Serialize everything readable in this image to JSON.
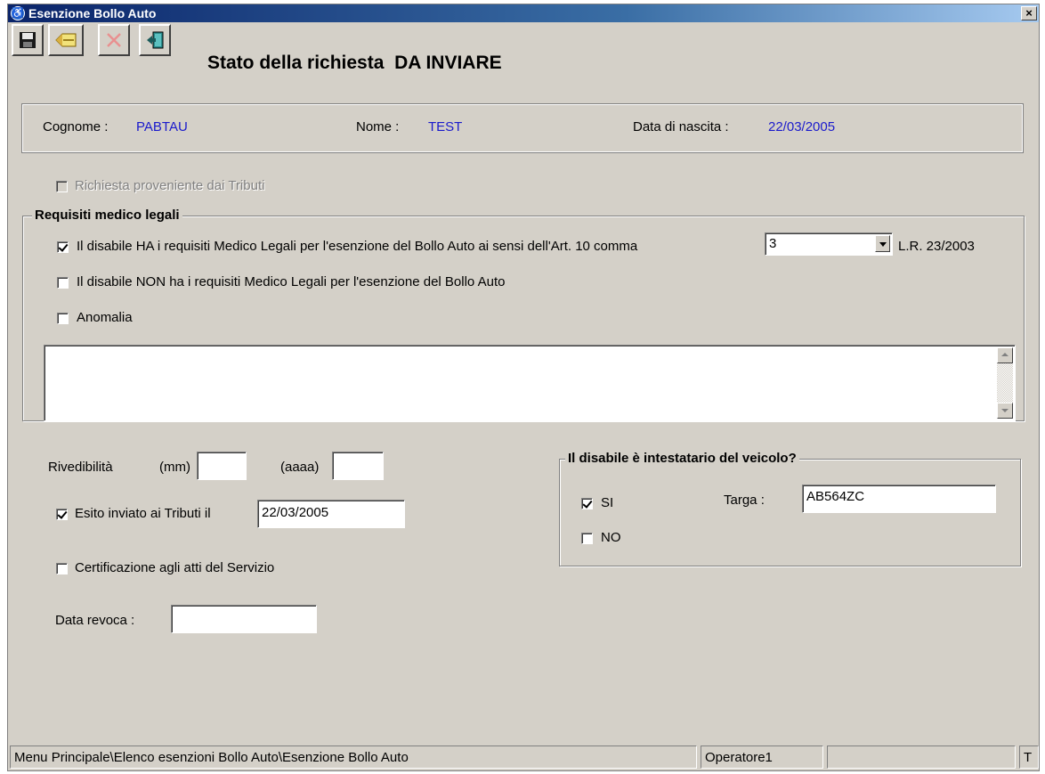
{
  "window": {
    "title": "Esenzione Bollo Auto",
    "close_label": "×"
  },
  "toolbar": {
    "save_icon": "floppy-disk-icon",
    "edit_icon": "pencil-icon",
    "delete_icon": "red-x-icon",
    "exit_icon": "exit-door-icon"
  },
  "status": {
    "label": "Stato della richiesta",
    "value": "DA INVIARE"
  },
  "person": {
    "surname_label": "Cognome :",
    "surname": "PABTAU",
    "name_label": "Nome :",
    "name": "TEST",
    "birth_label": "Data di nascita :",
    "birth_date": "22/03/2005"
  },
  "tributi_request": {
    "label": "Richiesta proveniente dai Tributi",
    "checked": false,
    "enabled": false
  },
  "requisiti": {
    "title": "Requisiti medico legali",
    "has_requirements_label": "Il disabile HA i requisiti Medico Legali per l'esenzione del Bollo Auto ai sensi dell'Art. 10 comma",
    "has_requirements_checked": true,
    "comma_value": "3",
    "law_label": "L.R. 23/2003",
    "no_requirements_label": "Il disabile NON ha i requisiti Medico Legali per l'esenzione del Bollo Auto",
    "no_requirements_checked": false,
    "anomaly_label": "Anomalia",
    "anomaly_checked": false,
    "notes": ""
  },
  "rivedibilita": {
    "label": "Rivedibilità",
    "month_label": "(mm)",
    "month_value": "",
    "year_label": "(aaaa)",
    "year_value": ""
  },
  "esito": {
    "label": "Esito inviato ai Tributi il",
    "checked": true,
    "date": "22/03/2005"
  },
  "certificazione": {
    "label": "Certificazione agli atti del Servizio",
    "checked": false
  },
  "revoca": {
    "label": "Data revoca :",
    "value": ""
  },
  "intestatario": {
    "title": "Il disabile è intestatario del veicolo?",
    "yes_label": "SI",
    "yes_checked": true,
    "no_label": "NO",
    "no_checked": false,
    "plate_label": "Targa :",
    "plate_value": "AB564ZC"
  },
  "statusbar": {
    "path": "Menu Principale\\Elenco esenzioni Bollo Auto\\Esenzione Bollo Auto",
    "operator": "Operatore1",
    "extra": "",
    "mode": "T"
  }
}
